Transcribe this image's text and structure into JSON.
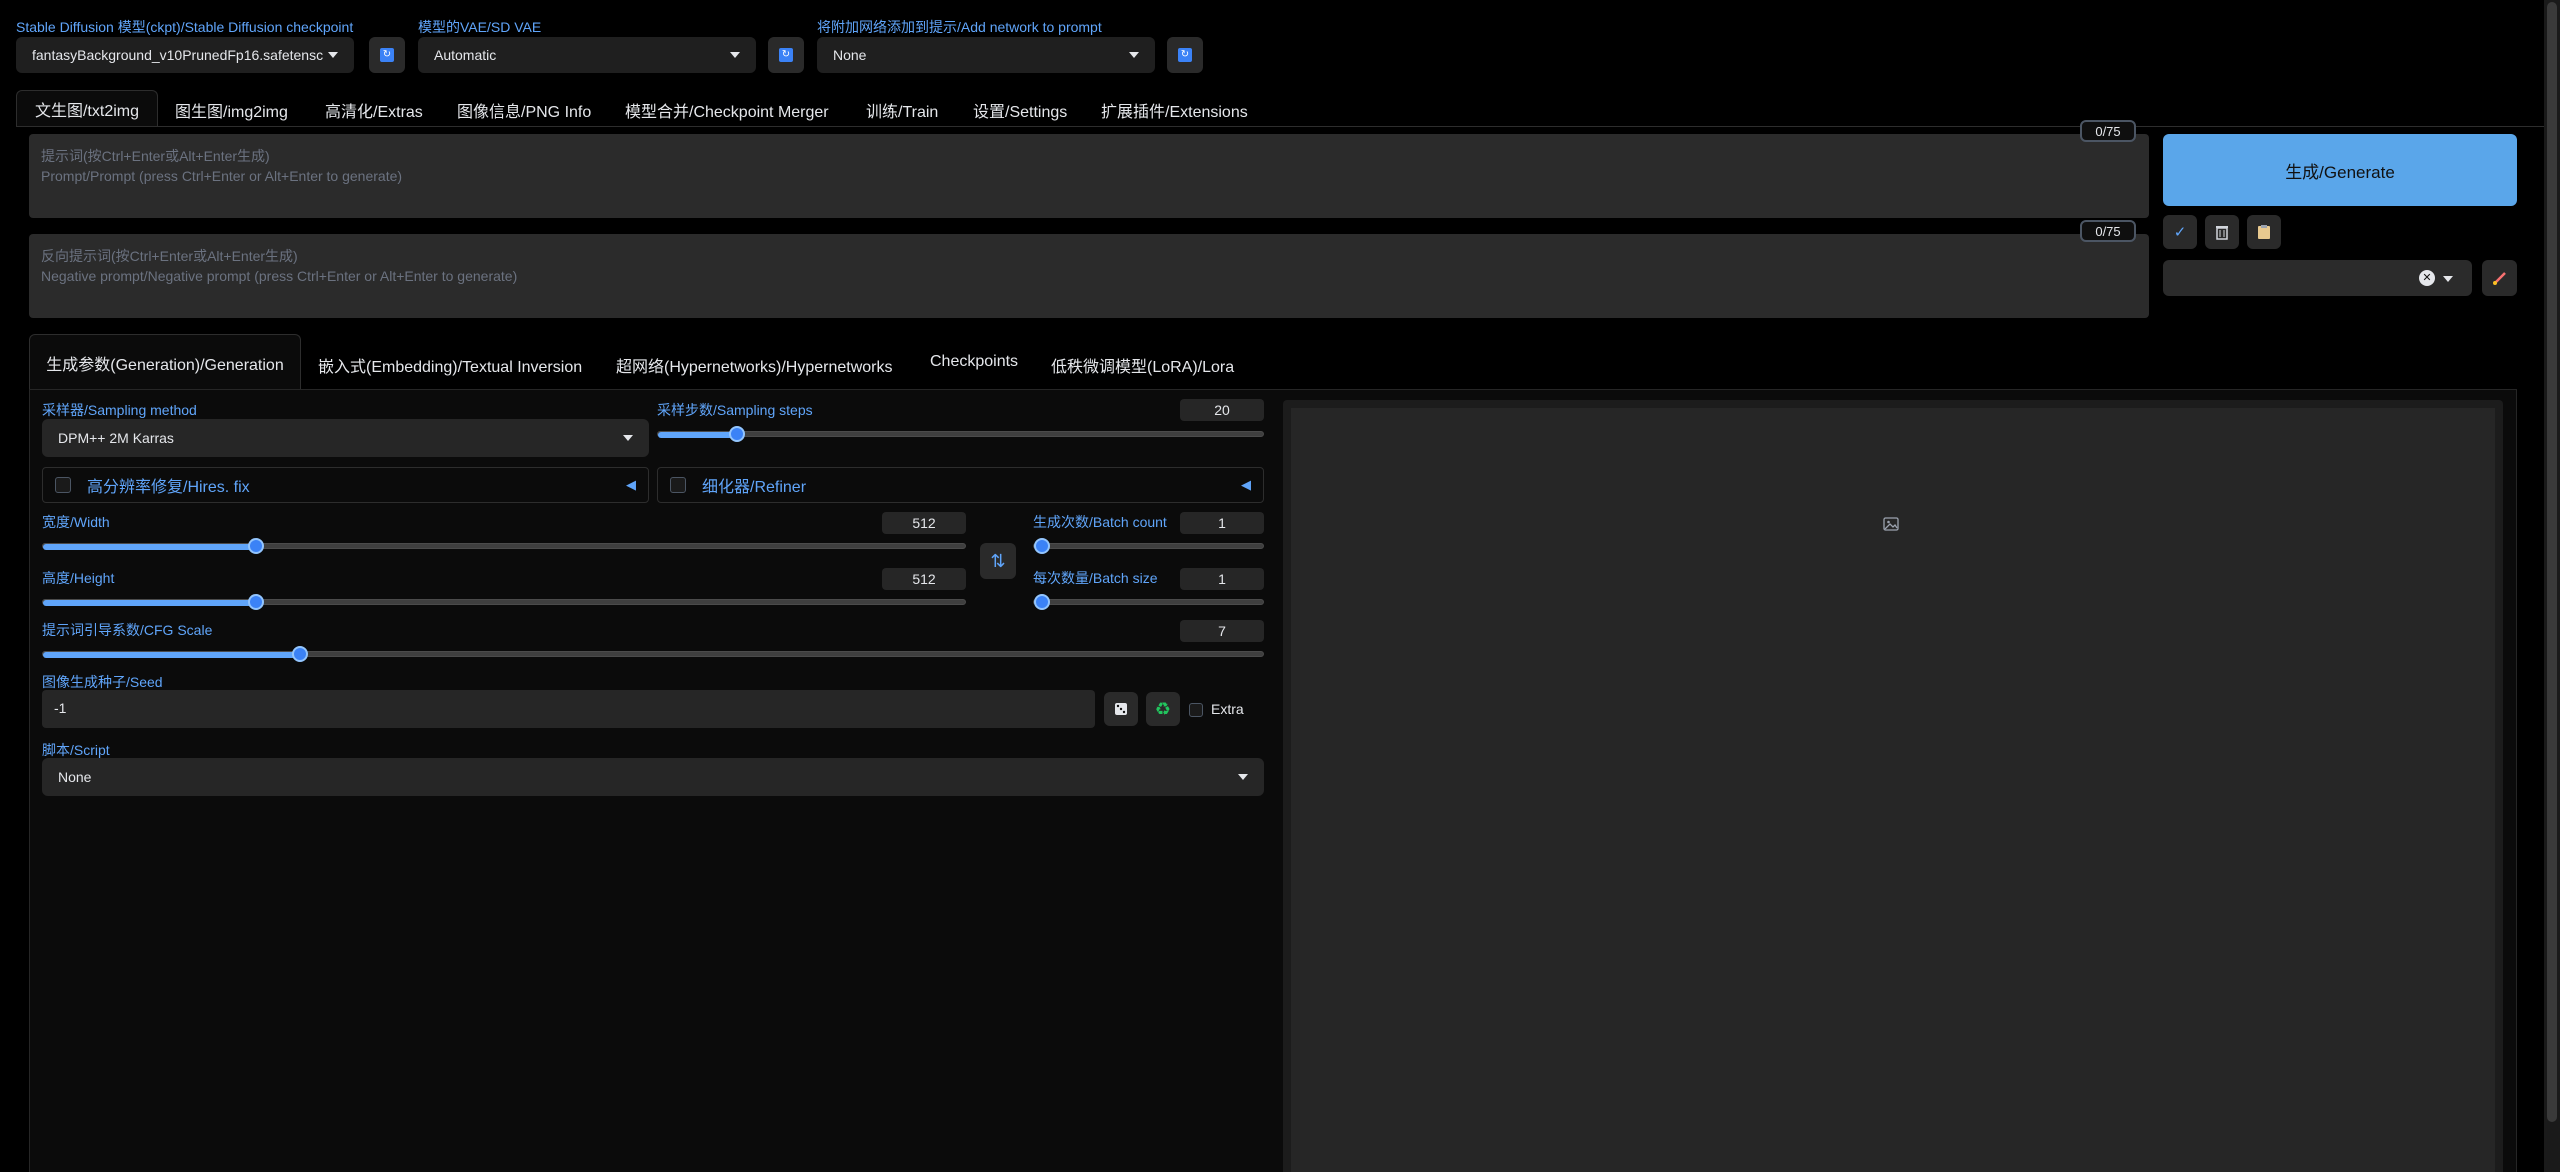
{
  "header": {
    "checkpoint": {
      "label": "Stable Diffusion 模型(ckpt)/Stable Diffusion checkpoint",
      "value": "fantasyBackground_v10PrunedFp16.safetensc"
    },
    "vae": {
      "label": "模型的VAE/SD VAE",
      "value": "Automatic"
    },
    "network": {
      "label": "将附加网络添加到提示/Add network to prompt",
      "value": "None"
    }
  },
  "main_tabs": [
    "文生图/txt2img",
    "图生图/img2img",
    "高清化/Extras",
    "图像信息/PNG Info",
    "模型合并/Checkpoint Merger",
    "训练/Train",
    "设置/Settings",
    "扩展插件/Extensions"
  ],
  "prompt": {
    "placeholder": "提示词(按Ctrl+Enter或Alt+Enter生成)\nPrompt/Prompt (press Ctrl+Enter or Alt+Enter to generate)",
    "counter": "0/75"
  },
  "negative_prompt": {
    "placeholder": "反向提示词(按Ctrl+Enter或Alt+Enter生成)\nNegative prompt/Negative prompt (press Ctrl+Enter or Alt+Enter to generate)",
    "counter": "0/75"
  },
  "generate_label": "生成/Generate",
  "tool_icons": [
    "check-icon",
    "trash-icon",
    "clipboard-icon"
  ],
  "styles_clear_glyph": "✕",
  "sub_tabs": [
    "生成参数(Generation)/Generation",
    "嵌入式(Embedding)/Textual Inversion",
    "超网络(Hypernetworks)/Hypernetworks",
    "Checkpoints",
    "低秩微调模型(LoRA)/Lora"
  ],
  "sampling_method": {
    "label": "采样器/Sampling method",
    "value": "DPM++ 2M Karras"
  },
  "sampling_steps": {
    "label": "采样步数/Sampling steps",
    "value": "20",
    "fraction": 0.13
  },
  "hires_fix": {
    "label": "高分辨率修复/Hires. fix",
    "checked": false
  },
  "refiner": {
    "label": "细化器/Refiner",
    "checked": false
  },
  "width": {
    "label": "宽度/Width",
    "value": "512",
    "fraction": 0.23
  },
  "height": {
    "label": "高度/Height",
    "value": "512",
    "fraction": 0.23
  },
  "swap_icon": "⇅",
  "batch_count": {
    "label": "生成次数/Batch count",
    "value": "1",
    "fraction": 0
  },
  "batch_size": {
    "label": "每次数量/Batch size",
    "value": "1",
    "fraction": 0
  },
  "cfg_scale": {
    "label": "提示词引导系数/CFG Scale",
    "value": "7",
    "fraction": 0.21
  },
  "seed": {
    "label": "图像生成种子/Seed",
    "value": "-1",
    "extra_label": "Extra"
  },
  "script": {
    "label": "脚本/Script",
    "value": "None"
  },
  "colors": {
    "accent": "#60a5fa",
    "generate": "#5aa6ea",
    "background": "#000000"
  }
}
